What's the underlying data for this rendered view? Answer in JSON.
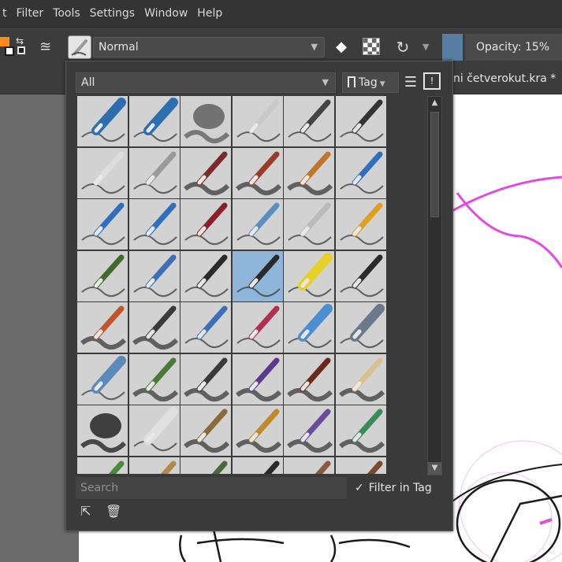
{
  "menubar": {
    "items": [
      "t",
      "Filter",
      "Tools",
      "Settings",
      "Window",
      "Help"
    ]
  },
  "toolbar": {
    "fg_color": "#ff8c1a",
    "bg_color": "#ffffff",
    "blend_mode": "Normal",
    "color_swatch": "#587fa3",
    "opacity": "Opacity: 15%",
    "icons": [
      "swap-colors-icon",
      "reset-colors-icon",
      "gradient-icon",
      "eraser-icon",
      "preserve-alpha-icon",
      "reload-preset-icon"
    ]
  },
  "tabs": {
    "document": "ni četverokut.kra *"
  },
  "presets_popup": {
    "tag_filter": "All",
    "tag_button": "Tag",
    "search_placeholder": "Search",
    "filter_in_tag": "Filter in Tag",
    "filter_in_tag_checked": true,
    "selected_index": 21,
    "columns": 6,
    "presets": [
      {
        "kind": "eraser",
        "color": "#2c6fb0"
      },
      {
        "kind": "eraser",
        "color": "#2c6fb0"
      },
      {
        "kind": "blob",
        "color": "#5a5a5a"
      },
      {
        "kind": "pen",
        "color": "#c9c9c9"
      },
      {
        "kind": "pen",
        "color": "#444444"
      },
      {
        "kind": "pen",
        "color": "#333333"
      },
      {
        "kind": "pencil",
        "color": "#dddddd"
      },
      {
        "kind": "pencil",
        "color": "#9a9a9a"
      },
      {
        "kind": "brush",
        "color": "#7a2a2a"
      },
      {
        "kind": "brush",
        "color": "#9a3b2a"
      },
      {
        "kind": "brush",
        "color": "#c0752a"
      },
      {
        "kind": "pencil",
        "color": "#2f6fbf"
      },
      {
        "kind": "pencil",
        "color": "#2f6fbf"
      },
      {
        "kind": "pencil",
        "color": "#2f6fbf"
      },
      {
        "kind": "pen",
        "color": "#8a1f2a"
      },
      {
        "kind": "pen",
        "color": "#5a8fbf"
      },
      {
        "kind": "pencil",
        "color": "#bbbbbb"
      },
      {
        "kind": "pencil",
        "color": "#e0a020"
      },
      {
        "kind": "pencil",
        "color": "#3f6a2a"
      },
      {
        "kind": "pen",
        "color": "#3d6fb8"
      },
      {
        "kind": "pen",
        "color": "#2a2a2a"
      },
      {
        "kind": "pen",
        "color": "#2a2a2a"
      },
      {
        "kind": "marker",
        "color": "#e8d02a"
      },
      {
        "kind": "pen",
        "color": "#2a2a2a"
      },
      {
        "kind": "brush",
        "color": "#c0552a"
      },
      {
        "kind": "brush",
        "color": "#3a3a3a"
      },
      {
        "kind": "pencil",
        "color": "#3d6fb8"
      },
      {
        "kind": "pencil",
        "color": "#b03050"
      },
      {
        "kind": "marker",
        "color": "#4a8fd0"
      },
      {
        "kind": "marker",
        "color": "#6a7a8a"
      },
      {
        "kind": "marker",
        "color": "#5a8ab8"
      },
      {
        "kind": "brush",
        "color": "#4a7a3a"
      },
      {
        "kind": "brush",
        "color": "#3a3a3a"
      },
      {
        "kind": "brush",
        "color": "#5a3a8a"
      },
      {
        "kind": "brush",
        "color": "#6a2a1a"
      },
      {
        "kind": "brush",
        "color": "#d8c090"
      },
      {
        "kind": "blob",
        "color": "#1a1a1a"
      },
      {
        "kind": "roller",
        "color": "#e0e0e0"
      },
      {
        "kind": "brush",
        "color": "#8a6a3a"
      },
      {
        "kind": "brush",
        "color": "#c08a2a"
      },
      {
        "kind": "brush",
        "color": "#6a4a9a"
      },
      {
        "kind": "brush",
        "color": "#3a8a5a"
      },
      {
        "kind": "pencil",
        "color": "#4a8a3a"
      },
      {
        "kind": "pencil",
        "color": "#b08a4a"
      },
      {
        "kind": "pencil",
        "color": "#4a6a3a"
      },
      {
        "kind": "pencil",
        "color": "#2a2a2a"
      },
      {
        "kind": "pencil",
        "color": "#8a5a3a"
      },
      {
        "kind": "pencil",
        "color": "#7a4a2a"
      }
    ]
  }
}
